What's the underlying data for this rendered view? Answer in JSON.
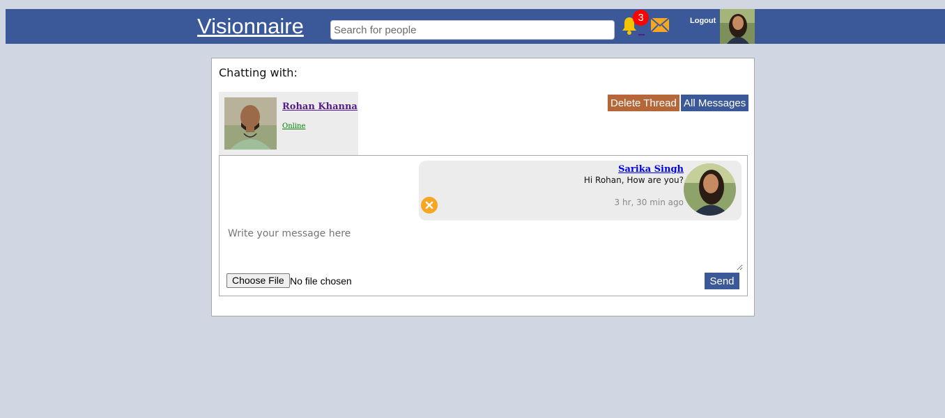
{
  "header": {
    "brand": "Visionnaire",
    "search_placeholder": "Search for people",
    "notification_count": "3",
    "logout_label": "Logout",
    "bar_color": "#3b5998",
    "icons": [
      "bell-icon",
      "mail-icon",
      "user-avatar"
    ]
  },
  "chat": {
    "title": "Chatting with:",
    "partner": {
      "name": "Rohan Khanna",
      "status": "Online"
    },
    "actions": {
      "delete_label": "Delete Thread",
      "all_messages_label": "All Messages"
    },
    "messages": [
      {
        "sender": "Sarika Singh",
        "text": "Hi Rohan, How are you?",
        "time": "3 hr, 30 min ago"
      }
    ],
    "composer": {
      "placeholder": "Write your message here",
      "file_button_label": "Choose File",
      "file_status": "No file chosen",
      "send_label": "Send"
    }
  },
  "colors": {
    "page_bg": "#d0d7e2",
    "accent": "#3b5998",
    "delete_button": "#b5673a",
    "badge": "#ff0000",
    "icon_yellow": "#f5c400",
    "online_green": "#008000"
  }
}
